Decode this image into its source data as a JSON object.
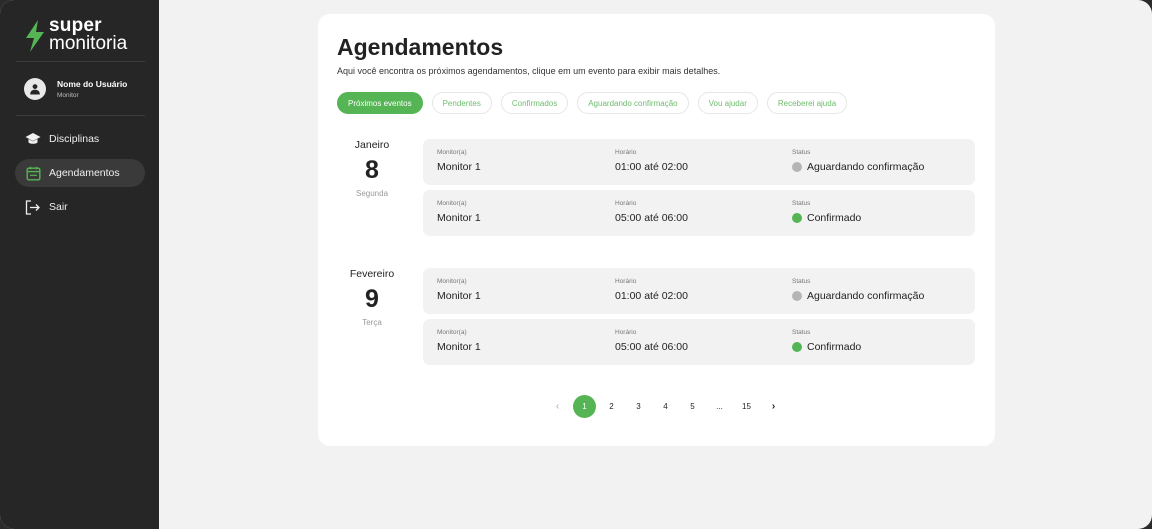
{
  "brand": {
    "line1": "super",
    "line2": "monitoria",
    "accent": "#55b555",
    "logo_icon": "lightning-bolt-icon"
  },
  "user": {
    "name": "Nome do Usuário",
    "role": "Monitor",
    "icon": "user-icon"
  },
  "nav": [
    {
      "label": "Disciplinas",
      "icon": "graduation-cap-icon",
      "active": false
    },
    {
      "label": "Agendamentos",
      "icon": "calendar-icon",
      "active": true
    },
    {
      "label": "Sair",
      "icon": "logout-icon",
      "active": false
    }
  ],
  "page": {
    "title": "Agendamentos",
    "subtitle": "Aqui você encontra os próximos agendamentos, clique em um evento para exibir mais detalhes."
  },
  "filters": [
    {
      "label": "Próximos eventos",
      "active": true
    },
    {
      "label": "Pendentes",
      "active": false
    },
    {
      "label": "Confirmados",
      "active": false
    },
    {
      "label": "Aguardando confirmação",
      "active": false
    },
    {
      "label": "Vou ajudar",
      "active": false
    },
    {
      "label": "Receberei ajuda",
      "active": false
    }
  ],
  "groups": [
    {
      "month": "Janeiro",
      "day": "8",
      "weekday": "Segunda",
      "events": [
        {
          "monitor_label": "Monitor(a)",
          "monitor": "Monitor 1",
          "time_label": "Horário",
          "time": "01:00 até 02:00",
          "status_label": "Status",
          "status": "Aguardando confirmação",
          "status_color": "#b5b5b5"
        },
        {
          "monitor_label": "Monitor(a)",
          "monitor": "Monitor 1",
          "time_label": "Horário",
          "time": "05:00 até 06:00",
          "status_label": "Status",
          "status": "Confirmado",
          "status_color": "#55b555"
        }
      ]
    },
    {
      "month": "Fevereiro",
      "day": "9",
      "weekday": "Terça",
      "events": [
        {
          "monitor_label": "Monitor(a)",
          "monitor": "Monitor 1",
          "time_label": "Horário",
          "time": "01:00 até 02:00",
          "status_label": "Status",
          "status": "Aguardando confirmação",
          "status_color": "#b5b5b5"
        },
        {
          "monitor_label": "Monitor(a)",
          "monitor": "Monitor 1",
          "time_label": "Horário",
          "time": "05:00 até 06:00",
          "status_label": "Status",
          "status": "Confirmado",
          "status_color": "#55b555"
        }
      ]
    }
  ],
  "pagination": {
    "prev": "‹",
    "pages": [
      "1",
      "2",
      "3",
      "4",
      "5",
      "...",
      "15"
    ],
    "current": "1",
    "next": "›"
  }
}
